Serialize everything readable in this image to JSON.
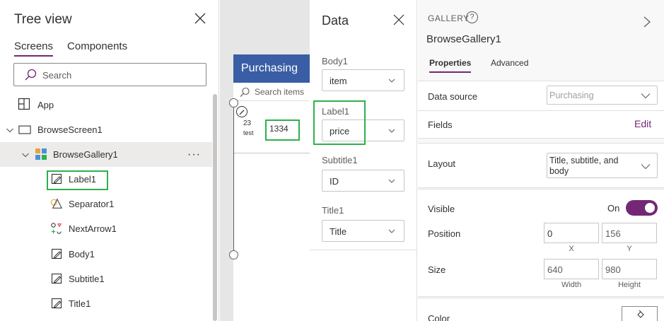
{
  "tree_view": {
    "title": "Tree view",
    "tabs": [
      {
        "label": "Screens",
        "active": true
      },
      {
        "label": "Components",
        "active": false
      }
    ],
    "search_placeholder": "Search",
    "items": [
      {
        "label": "App",
        "icon": "app-icon"
      },
      {
        "label": "BrowseScreen1",
        "icon": "screen-icon"
      },
      {
        "label": "BrowseGallery1",
        "icon": "gallery-icon",
        "selected": true
      },
      {
        "label": "Label1",
        "icon": "label-icon",
        "highlighted": true
      },
      {
        "label": "Separator1",
        "icon": "separator-icon"
      },
      {
        "label": "NextArrow1",
        "icon": "icons-icon"
      },
      {
        "label": "Body1",
        "icon": "label-icon"
      },
      {
        "label": "Subtitle1",
        "icon": "label-icon"
      },
      {
        "label": "Title1",
        "icon": "label-icon"
      }
    ],
    "more_menu": "···"
  },
  "canvas": {
    "header_title": "Purchasing",
    "search_placeholder": "Search items",
    "gallery_item": {
      "subtitle": "23",
      "title": "test",
      "price": "1334"
    }
  },
  "data_panel": {
    "title": "Data",
    "fields": [
      {
        "label": "Body1",
        "value": "item",
        "highlighted": false
      },
      {
        "label": "Label1",
        "value": "price",
        "highlighted": true
      },
      {
        "label": "Subtitle1",
        "value": "ID",
        "highlighted": false
      },
      {
        "label": "Title1",
        "value": "Title",
        "highlighted": false
      }
    ]
  },
  "properties": {
    "control_type": "GALLERY",
    "control_name": "BrowseGallery1",
    "tabs": [
      {
        "label": "Properties",
        "active": true
      },
      {
        "label": "Advanced",
        "active": false
      }
    ],
    "data_source_label": "Data source",
    "data_source_value": "Purchasing",
    "fields_label": "Fields",
    "fields_edit": "Edit",
    "layout_label": "Layout",
    "layout_value": "Title, subtitle, and body",
    "visible_label": "Visible",
    "visible_state": "On",
    "visible_on": true,
    "position_label": "Position",
    "position_x": "0",
    "position_y": "156",
    "x_caption": "X",
    "y_caption": "Y",
    "size_label": "Size",
    "size_width": "640",
    "size_height": "980",
    "width_caption": "Width",
    "height_caption": "Height",
    "color_label": "Color"
  },
  "colors": {
    "accent": "#742774",
    "highlight_box": "#2db14a",
    "app_header": "#3a5ea6"
  }
}
